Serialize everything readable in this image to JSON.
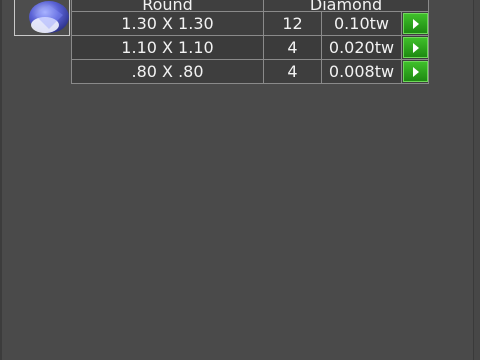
{
  "table": {
    "headers": [
      "Round",
      "Diamond"
    ],
    "rows": [
      {
        "size": "1.30 X 1.30",
        "count": "12",
        "weight": "0.10tw"
      },
      {
        "size": "1.10 X 1.10",
        "count": "4",
        "weight": "0.020tw"
      },
      {
        "size": ".80 X .80",
        "count": "4",
        "weight": "0.008tw"
      }
    ]
  },
  "icons": {
    "thumbnail": "gemstone-icon",
    "row_action": "play-arrow-icon"
  },
  "colors": {
    "button_green": "#2aa61b",
    "background": "#474747"
  }
}
